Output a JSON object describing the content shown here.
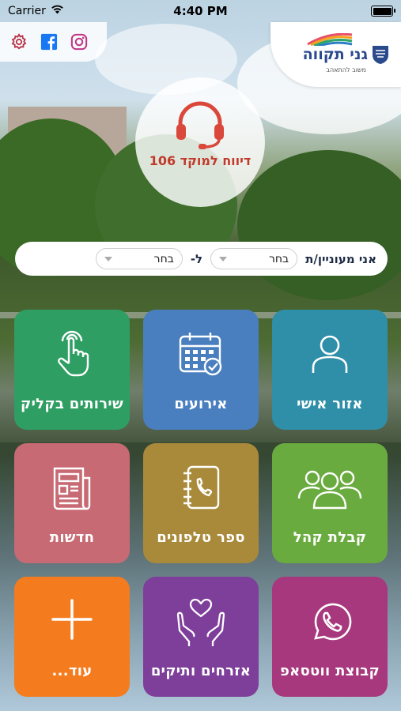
{
  "status_bar": {
    "carrier": "Carrier",
    "time": "4:40 PM"
  },
  "logo": {
    "name": "גני תקווה",
    "tagline": "משוב להתאהב"
  },
  "report": {
    "label": "דיווח למוקד 106",
    "icon": "headset-icon"
  },
  "interest": {
    "label": "אני מעוניין/ת",
    "connector": "ל-",
    "select1_value": "בחר",
    "select2_value": "בחר"
  },
  "tiles": [
    {
      "label": "אזור אישי",
      "icon": "user-icon",
      "color": "#2f8fa8"
    },
    {
      "label": "אירועים",
      "icon": "calendar-icon",
      "color": "#4a7fbf"
    },
    {
      "label": "שירותים בקליק",
      "icon": "tap-hand-icon",
      "color": "#2e9e63"
    },
    {
      "label": "קבלת קהל",
      "icon": "group-icon",
      "color": "#6aab3f"
    },
    {
      "label": "ספר טלפונים",
      "icon": "phonebook-icon",
      "color": "#a98a3a"
    },
    {
      "label": "חדשות",
      "icon": "newspaper-icon",
      "color": "#c86a73"
    },
    {
      "label": "קבוצת ווטסאפ",
      "icon": "whatsapp-icon",
      "color": "#a7387d"
    },
    {
      "label": "אזרחים ותיקים",
      "icon": "care-hands-icon",
      "color": "#7e3f9a"
    },
    {
      "label": "עוד...",
      "icon": "plus-icon",
      "color": "#f47b1e"
    }
  ],
  "colors": {
    "report_red": "#c0392b",
    "facebook": "#1877f2",
    "instagram": "#c13584",
    "settings": "#b5344a"
  }
}
